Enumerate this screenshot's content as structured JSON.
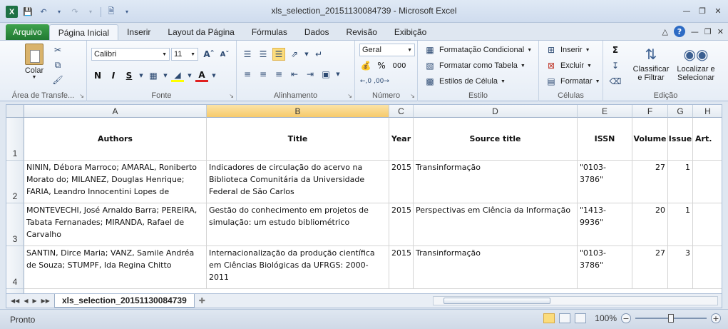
{
  "window": {
    "title": "xls_selection_20151130084739  -  Microsoft Excel",
    "logo_letter": "X"
  },
  "ribbon_tabs": [
    {
      "label": "Arquivo"
    },
    {
      "label": "Página Inicial"
    },
    {
      "label": "Inserir"
    },
    {
      "label": "Layout da Página"
    },
    {
      "label": "Fórmulas"
    },
    {
      "label": "Dados"
    },
    {
      "label": "Revisão"
    },
    {
      "label": "Exibição"
    }
  ],
  "clipboard": {
    "paste_label": "Colar",
    "group_label": "Área de Transfe..."
  },
  "font": {
    "name": "Calibri",
    "size": "11",
    "bold": "N",
    "italic": "I",
    "underline": "S",
    "group_label": "Fonte"
  },
  "alignment": {
    "group_label": "Alinhamento"
  },
  "number": {
    "format": "Geral",
    "percent": "%",
    "thousands": "000",
    "group_label": "Número"
  },
  "styles": {
    "conditional": "Formatação Condicional",
    "as_table": "Formatar como Tabela",
    "cell_styles": "Estilos de Célula",
    "group_label": "Estilo"
  },
  "cells": {
    "insert": "Inserir",
    "delete": "Excluir",
    "format": "Formatar",
    "group_label": "Células"
  },
  "editing": {
    "sort_filter_1": "Classificar",
    "sort_filter_2": "e Filtrar",
    "find_select_1": "Localizar e",
    "find_select_2": "Selecionar",
    "group_label": "Edição"
  },
  "grid": {
    "columns": [
      "A",
      "B",
      "C",
      "D",
      "E",
      "F",
      "G",
      "H"
    ],
    "row_numbers": [
      "1",
      "2",
      "3",
      "4"
    ],
    "header_row": [
      "Authors",
      "Title",
      "Year",
      "Source title",
      "ISSN",
      "Volume",
      "Issue",
      "Art."
    ],
    "rows": [
      {
        "authors": "NININ, Débora Marroco; AMARAL, Roniberto Morato do; MILANEZ, Douglas Henrique; FARIA, Leandro Innocentini Lopes de",
        "title": "Indicadores de circulação do acervo na Biblioteca Comunitária da Universidade Federal de São Carlos",
        "year": "2015",
        "source": "Transinformação",
        "issn": "\"0103-3786\"",
        "volume": "27",
        "issue": "1"
      },
      {
        "authors": "MONTEVECHI, José Arnaldo Barra; PEREIRA, Tabata Fernanades; MIRANDA, Rafael de Carvalho",
        "title": "Gestão do conhecimento em projetos de simulação: um estudo bibliométrico",
        "year": "2015",
        "source": "Perspectivas em Ciência da Informação",
        "issn": "\"1413-9936\"",
        "volume": "20",
        "issue": "1"
      },
      {
        "authors": "SANTIN, Dirce Maria; VANZ, Samile Andréa de Souza; STUMPF, Ida Regina Chitto",
        "title": "Internacionalização da produção científica em Ciências Biológicas da UFRGS: 2000-2011",
        "year": "2015",
        "source": "Transinformação",
        "issn": "\"0103-3786\"",
        "volume": "27",
        "issue": "3"
      }
    ]
  },
  "sheet_tab": {
    "label": "xls_selection_20151130084739"
  },
  "status": {
    "ready": "Pronto",
    "zoom": "100%",
    "zoom_level": 1.0
  }
}
